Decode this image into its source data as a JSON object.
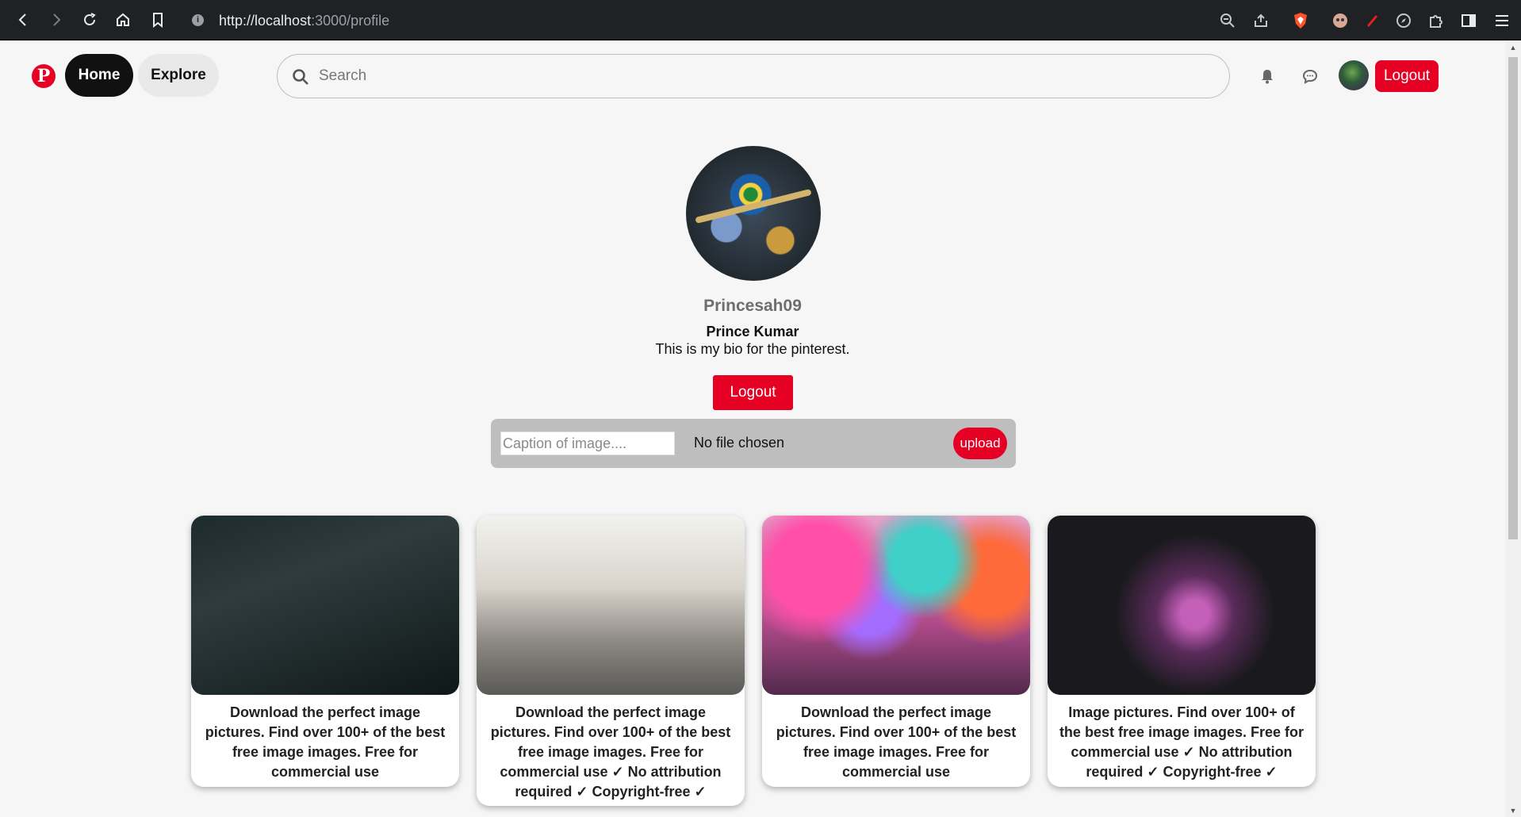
{
  "browser": {
    "url_host": "http://localhost",
    "url_rest": ":3000/profile"
  },
  "header": {
    "logo": "P",
    "home_label": "Home",
    "explore_label": "Explore",
    "search_placeholder": "Search",
    "logout_label": "Logout"
  },
  "profile": {
    "username": "Princesah09",
    "fullname": "Prince Kumar",
    "bio": "This is my bio for the pinterest.",
    "logout_label": "Logout"
  },
  "upload": {
    "caption_placeholder": "Caption of image....",
    "file_status": "No file chosen",
    "button_label": "upload"
  },
  "cards": [
    {
      "caption": "Download the perfect image pictures. Find over 100+ of the best free image images. Free for commercial use"
    },
    {
      "caption": "Download the perfect image pictures. Find over 100+ of the best free image images. Free for commercial use ✓ No attribution required ✓ Copyright-free ✓"
    },
    {
      "caption": "Download the perfect image pictures. Find over 100+ of the best free image images. Free for commercial use"
    },
    {
      "caption": "Image pictures. Find over 100+ of the best free image images. Free for commercial use ✓ No attribution required ✓ Copyright-free ✓"
    }
  ],
  "colors": {
    "brand": "#e60023",
    "page_bg": "#f6f6f6",
    "upload_bg": "#bebebe"
  }
}
